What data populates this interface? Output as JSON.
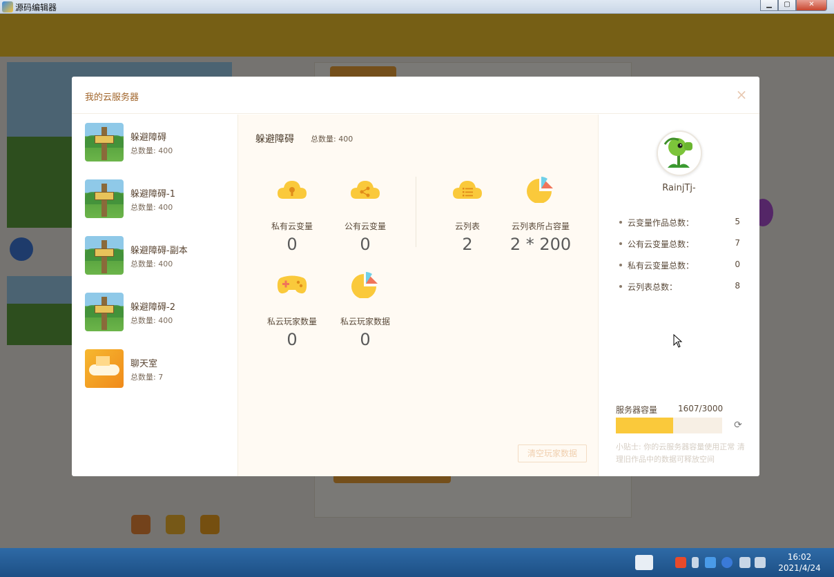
{
  "window": {
    "title": "源码编辑器",
    "min_glyph": "▁",
    "max_glyph": "▢",
    "close_glyph": "✕"
  },
  "modal": {
    "title": "我的云服务器",
    "close_glyph": "×"
  },
  "projects": [
    {
      "name": "躲避障碍",
      "count": "总数量: 400",
      "thumb": "game"
    },
    {
      "name": "躲避障碍-1",
      "count": "总数量: 400",
      "thumb": "game"
    },
    {
      "name": "躲避障碍-副本",
      "count": "总数量: 400",
      "thumb": "game"
    },
    {
      "name": "躲避障碍-2",
      "count": "总数量: 400",
      "thumb": "game"
    },
    {
      "name": "聊天室",
      "count": "总数量: 7",
      "thumb": "chat"
    }
  ],
  "detail": {
    "title": "躲避障碍",
    "total": "总数量: 400",
    "stats": [
      {
        "label": "私有云变量",
        "value": "0",
        "icon": "cloud-lock-icon"
      },
      {
        "label": "公有云变量",
        "value": "0",
        "icon": "cloud-share-icon"
      },
      {
        "label": "云列表",
        "value": "2",
        "icon": "cloud-list-icon"
      },
      {
        "label": "云列表所占容量",
        "value": "2 * 200",
        "icon": "pie-chart-icon"
      },
      {
        "label": "私云玩家数量",
        "value": "0",
        "icon": "gamepad-icon"
      },
      {
        "label": "私云玩家数据",
        "value": "0",
        "icon": "pie-chart-icon"
      }
    ],
    "clear_button": "清空玩家数据"
  },
  "profile": {
    "username": "RainjTj-",
    "summary": [
      {
        "key": "云变量作品总数：",
        "value": "5"
      },
      {
        "key": "公有云变量总数：",
        "value": "7"
      },
      {
        "key": "私有云变量总数：",
        "value": "0"
      },
      {
        "key": "云列表总数：",
        "value": "8"
      }
    ],
    "capacity_label": "服务器容量",
    "capacity_value": "1607/3000",
    "capacity_used": 1607,
    "capacity_total": 3000,
    "tip": "小贴士: 你的云服务器容量使用正常 清理旧作品中的数据可释放空间"
  },
  "taskbar": {
    "time": "16:02",
    "date": "2021/4/24"
  },
  "colors": {
    "accent": "#fac93b",
    "brand": "#f7c62d",
    "title": "#a0642a"
  }
}
